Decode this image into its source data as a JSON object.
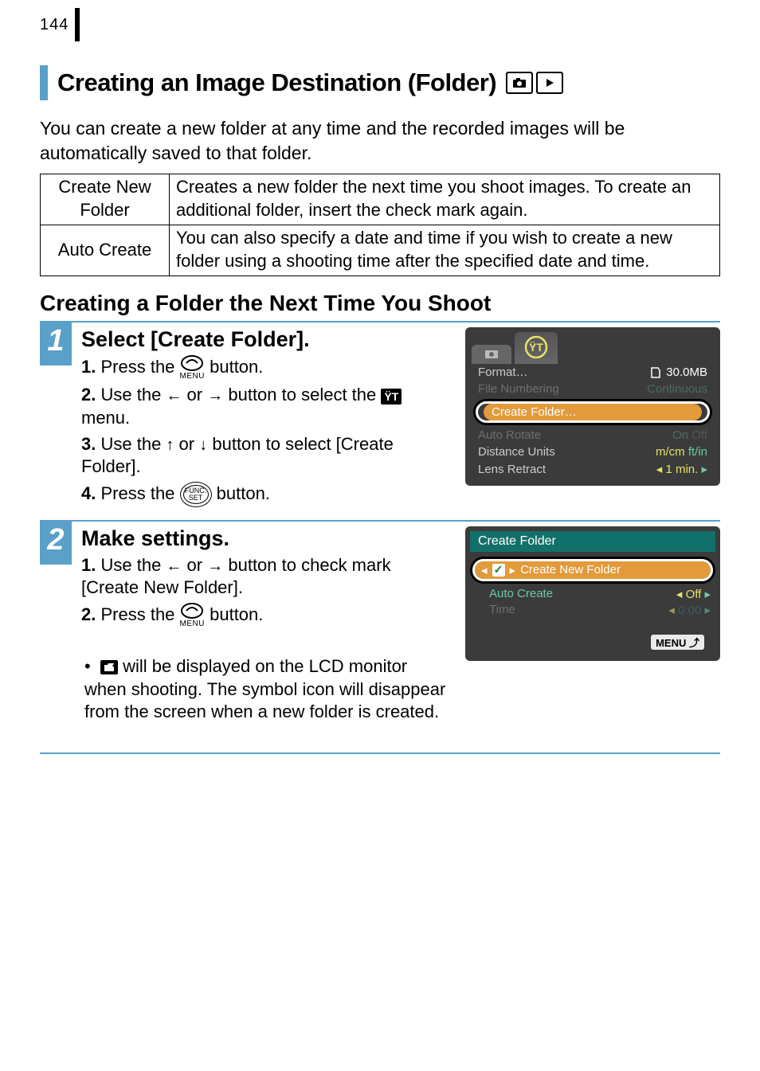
{
  "page_number": "144",
  "heading": "Creating an Image Destination (Folder)",
  "intro": "You can create a new folder at any time and the recorded images will be automatically saved to that folder.",
  "table": [
    {
      "label": "Create New Folder",
      "desc": "Creates a new folder the next time you shoot images. To create an additional folder, insert the check mark again."
    },
    {
      "label": "Auto Create",
      "desc": "You can also specify a date and time if you wish to create a new folder using a shooting time after the specified date and time."
    }
  ],
  "sub_heading": "Creating a Folder the Next Time You Shoot",
  "step1": {
    "num": "1",
    "title": "Select [Create Folder].",
    "l1a": "1.",
    "l1b": "Press the ",
    "l1c": " button.",
    "l2a": "2.",
    "l2b": "Use the ",
    "l2c": " or ",
    "l2d": " button to select the ",
    "l2e": " menu.",
    "l3a": "3.",
    "l3b": "Use the ",
    "l3c": " or ",
    "l3d": " button to select [Create Folder].",
    "l4a": "4.",
    "l4b": "Press the ",
    "l4c": " button.",
    "func_label": "FUNC.\nSET",
    "menu_label": "MENU",
    "tools_glyph": "ŸT"
  },
  "step2": {
    "num": "2",
    "title": "Make settings.",
    "l1a": "1.",
    "l1b": "Use the ",
    "l1c": " or ",
    "l1d": " button to check mark [Create New Folder].",
    "l2a": "2.",
    "l2b": "Press the ",
    "l2c": " button.",
    "bullet": " will be displayed on the LCD monitor when shooting. The symbol icon will disappear from the screen when a new folder is created."
  },
  "cam1": {
    "r_format": "Format…",
    "r_format_v": "30.0MB",
    "r_filenum": "File Numbering",
    "r_filenum_v": "Continuous",
    "r_create": "Create Folder…",
    "r_rotate": "Auto Rotate",
    "r_rotate_v_on": "On",
    "r_rotate_v_off": "Off",
    "r_dist": "Distance Units",
    "r_dist_v1": "m/cm",
    "r_dist_v2": "ft/in",
    "r_lens": "Lens Retract",
    "r_lens_v": "1 min."
  },
  "cam2": {
    "title": "Create Folder",
    "opt": "Create New Folder",
    "auto": "Auto Create",
    "auto_v": "Off",
    "time": "Time",
    "time_v": "0:00",
    "back": "MENU"
  }
}
